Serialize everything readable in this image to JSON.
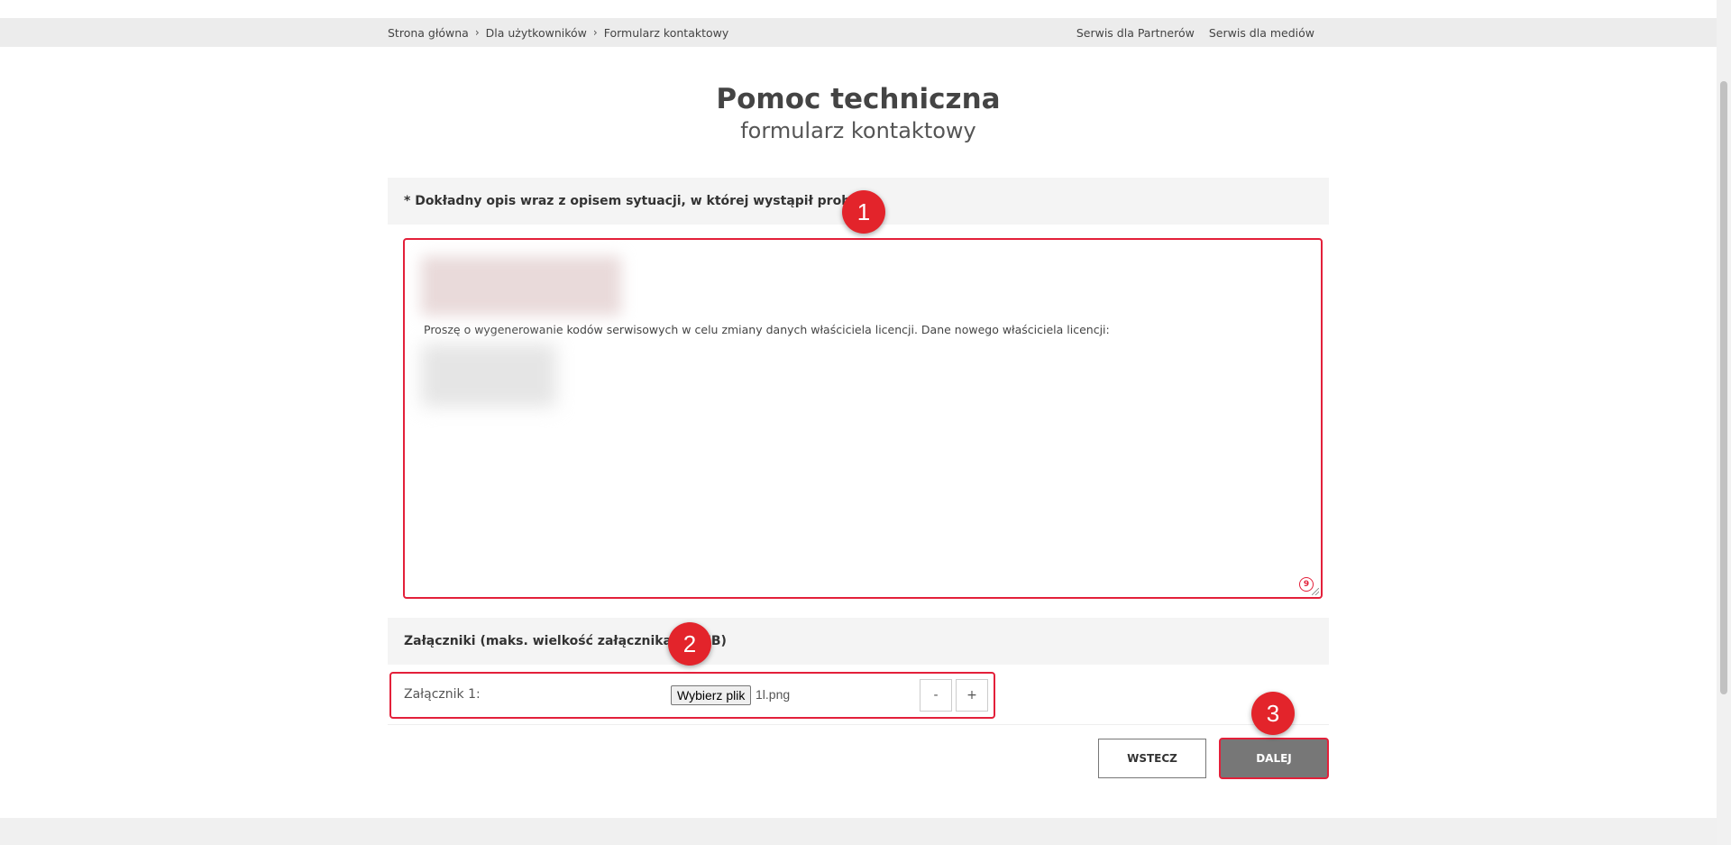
{
  "breadcrumb": {
    "items": [
      "Strona główna",
      "Dla użytkowników",
      "Formularz kontaktowy"
    ],
    "separator": "›"
  },
  "top_links": [
    "Serwis dla Partnerów",
    "Serwis dla mediów"
  ],
  "page": {
    "title": "Pomoc techniczna",
    "subtitle": "formularz kontaktowy"
  },
  "description": {
    "header": "* Dokładny opis wraz z opisem sytuacji, w której wystąpił problem",
    "text": "Proszę o wygenerowanie kodów serwisowych w celu zmiany danych właściciela licencji. Dane nowego właściciela licencji:",
    "counter": "9"
  },
  "attachments": {
    "header": "Załączniki (maks. wielkość załącznika: 20MB)",
    "label": "Załącznik 1:",
    "file_button": "Wybierz plik",
    "file_name": "1l.png",
    "minus": "-",
    "plus": "+"
  },
  "buttons": {
    "back": "WSTECZ",
    "next": "DALEJ"
  },
  "markers": [
    "1",
    "2",
    "3"
  ],
  "colors": {
    "accent": "#e3203a",
    "marker": "#e3242b",
    "next_button_bg": "#777777",
    "section_bg": "#f4f4f4"
  }
}
